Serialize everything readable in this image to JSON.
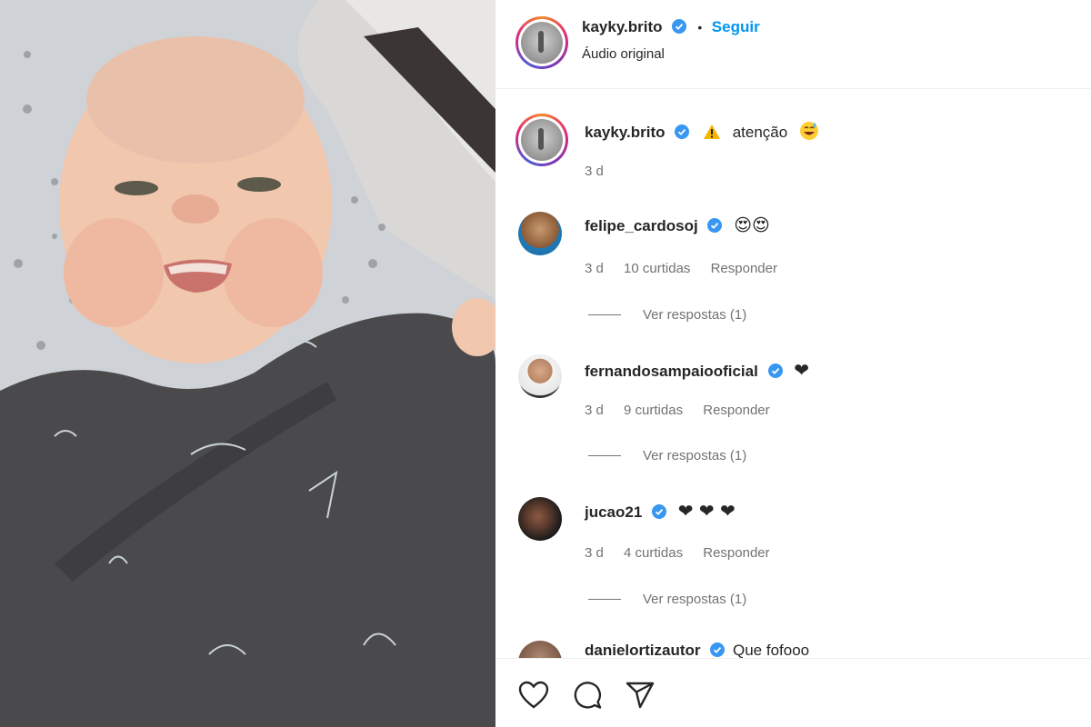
{
  "post": {
    "author": "kayky.brito",
    "follow_label": "Seguir",
    "audio": "Áudio original",
    "caption_text": "atenção",
    "caption_time": "3 d"
  },
  "comments": [
    {
      "user": "felipe_cardosoj",
      "text": "😍😍",
      "time": "3 d",
      "likes": "10 curtidas",
      "reply": "Responder",
      "view_replies": "Ver respostas (1)"
    },
    {
      "user": "fernandosampaiooficial",
      "text": "❤",
      "time": "3 d",
      "likes": "9 curtidas",
      "reply": "Responder",
      "view_replies": "Ver respostas (1)"
    },
    {
      "user": "jucao21",
      "text": "❤ ❤ ❤",
      "time": "3 d",
      "likes": "4 curtidas",
      "reply": "Responder",
      "view_replies": "Ver respostas (1)"
    },
    {
      "user": "danielortizautor",
      "text": "Que fofooo"
    }
  ],
  "icons": {
    "verified": "verified-badge-icon",
    "warning": "warning-icon",
    "like": "heart-outline-icon",
    "comment": "comment-icon",
    "share": "paper-plane-icon"
  },
  "colors": {
    "verified": "#3897f0",
    "follow": "#0095f6",
    "heart": "#ed1c36"
  }
}
